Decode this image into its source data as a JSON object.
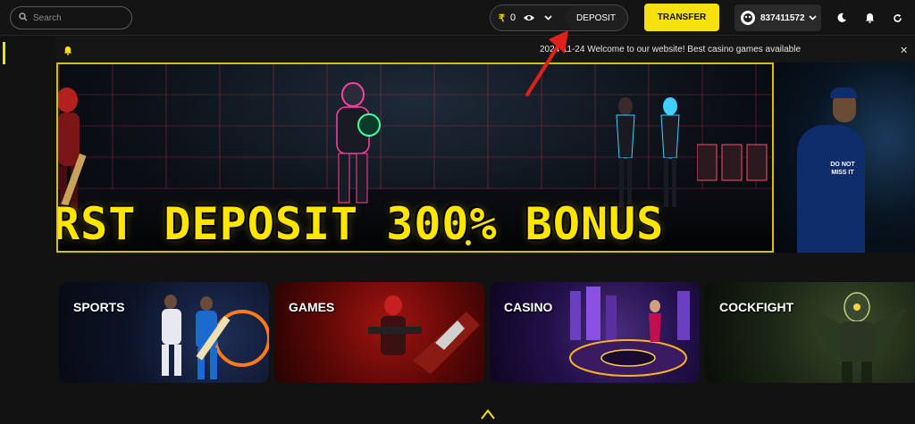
{
  "search": {
    "placeholder": "Search"
  },
  "wallet": {
    "currency_symbol": "₹",
    "balance": "0",
    "deposit_label": "DEPOSIT"
  },
  "transfer_label": "TRANSFER",
  "user": {
    "id": "837411572"
  },
  "notice": {
    "message": "2024-11-24  Welcome to our website! Best casino games available"
  },
  "banner": {
    "headline": "RST DEPOSIT 300% BONUS",
    "side_shirt_text": "DO NOT MISS IT"
  },
  "categories": [
    {
      "label": "SPORTS"
    },
    {
      "label": "GAMES"
    },
    {
      "label": "CASINO"
    },
    {
      "label": "COCKFIGHT"
    }
  ],
  "colors": {
    "accent": "#f7e10d",
    "background": "#121212",
    "arrow": "#e0201b"
  }
}
